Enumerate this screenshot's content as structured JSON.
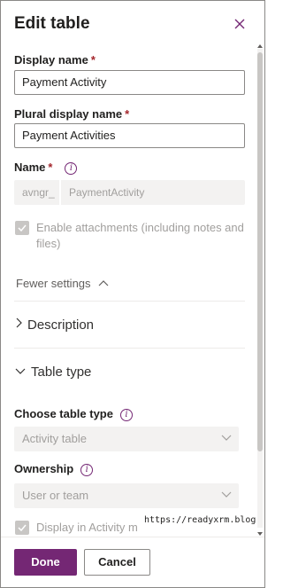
{
  "panel": {
    "title": "Edit table",
    "close_icon": "close-icon"
  },
  "form": {
    "display_name": {
      "label": "Display name",
      "required": "*",
      "value": "Payment Activity"
    },
    "plural_display_name": {
      "label": "Plural display name",
      "required": "*",
      "value": "Payment Activities"
    },
    "name": {
      "label": "Name",
      "required": "*",
      "info_icon": "i",
      "prefix": "avngr_",
      "value": "PaymentActivity"
    },
    "enable_attachments": {
      "label_line1": "Enable attachments (including notes and",
      "label_line2": "files)",
      "checked": true
    },
    "fewer_settings": "Fewer settings",
    "description_section": "Description",
    "table_type_section": "Table type",
    "choose_table_type": {
      "label": "Choose table type",
      "info_icon": "i",
      "value": "Activity table"
    },
    "ownership": {
      "label": "Ownership",
      "info_icon": "i",
      "value": "User or team"
    },
    "display_in_activity_menus": {
      "label": "Display in Activity m",
      "checked": true
    }
  },
  "watermark": "https://readyxrm.blog",
  "footer": {
    "done_label": "Done",
    "cancel_label": "Cancel"
  },
  "colors": {
    "accent": "#742774",
    "required": "#a4262c",
    "disabled_bg": "#f3f2f1",
    "disabled_text": "#a19f9d"
  }
}
